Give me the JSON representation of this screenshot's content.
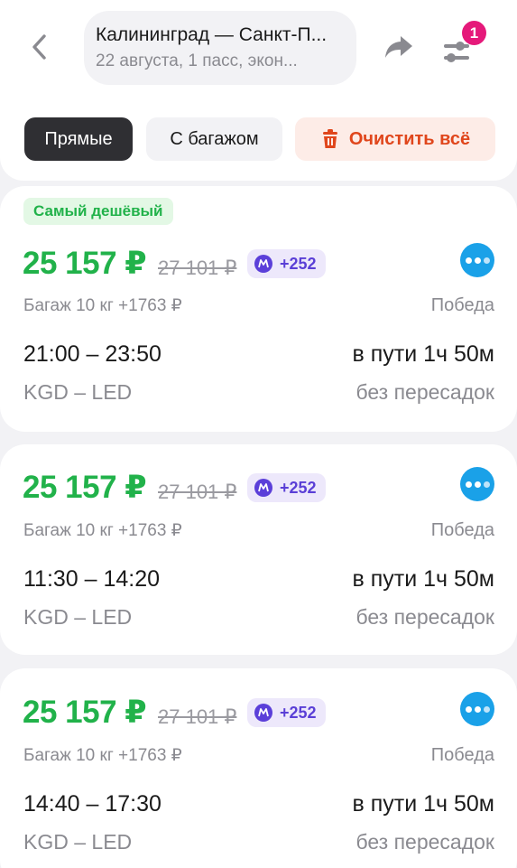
{
  "header": {
    "route_title": "Калининград — Санкт-П...",
    "route_subtitle": "22 августа, 1 пасс, экон...",
    "filter_badge_count": "1",
    "icons": {
      "back": "chevron-left-icon",
      "share": "share-arrow-icon",
      "filter": "filter-sliders-icon"
    }
  },
  "chips": {
    "direct": "Прямые",
    "baggage": "С багажом",
    "clear": "Очистить всё"
  },
  "colors": {
    "price_green": "#21b24a",
    "clear_red": "#e0461c",
    "badge_pink": "#e5197a",
    "bonus_purple": "#5b3fd9",
    "airline_blue": "#1aa1e8"
  },
  "flights": [
    {
      "tag": "Самый дешёвый",
      "price": "25 157 ₽",
      "old_price": "27 101 ₽",
      "bonus": "+252",
      "baggage": "Багаж 10 кг +1763 ₽",
      "airline": "Победа",
      "times": "21:00 – 23:50",
      "duration": "в пути 1ч 50м",
      "codes": "KGD – LED",
      "stops": "без пересадок"
    },
    {
      "price": "25 157 ₽",
      "old_price": "27 101 ₽",
      "bonus": "+252",
      "baggage": "Багаж 10 кг +1763 ₽",
      "airline": "Победа",
      "times": "11:30 – 14:20",
      "duration": "в пути 1ч 50м",
      "codes": "KGD – LED",
      "stops": "без пересадок"
    },
    {
      "price": "25 157 ₽",
      "old_price": "27 101 ₽",
      "bonus": "+252",
      "baggage": "Багаж 10 кг +1763 ₽",
      "airline": "Победа",
      "times": "14:40 – 17:30",
      "duration": "в пути 1ч 50м",
      "codes": "KGD – LED",
      "stops": "без пересадок"
    }
  ]
}
